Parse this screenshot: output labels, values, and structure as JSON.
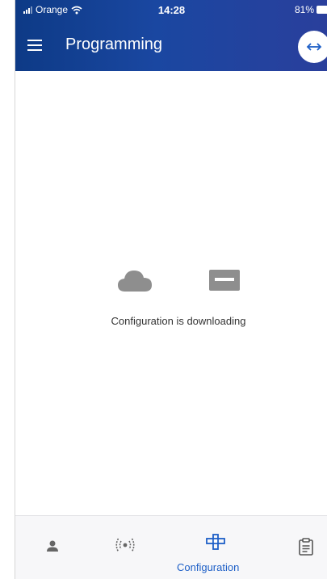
{
  "status_bar": {
    "carrier": "Orange",
    "time": "14:28",
    "battery": "81%"
  },
  "app_bar": {
    "title": "Programming",
    "menu_icon": "hamburger-menu-icon",
    "action_icon": "swap-horizontal-icon"
  },
  "content": {
    "message": "Configuration is downloading",
    "icons": [
      "cloud-icon",
      "card-icon"
    ]
  },
  "bottom_nav": {
    "items": [
      {
        "icon": "person-icon",
        "label": ""
      },
      {
        "icon": "radar-icon",
        "label": ""
      },
      {
        "icon": "configuration-icon",
        "label": "Configuration",
        "active": true
      },
      {
        "icon": "clipboard-icon",
        "label": ""
      }
    ]
  },
  "colors": {
    "header": "#1a47a1",
    "accent": "#1d5fc7",
    "icon_gray": "#8e8e8e"
  }
}
